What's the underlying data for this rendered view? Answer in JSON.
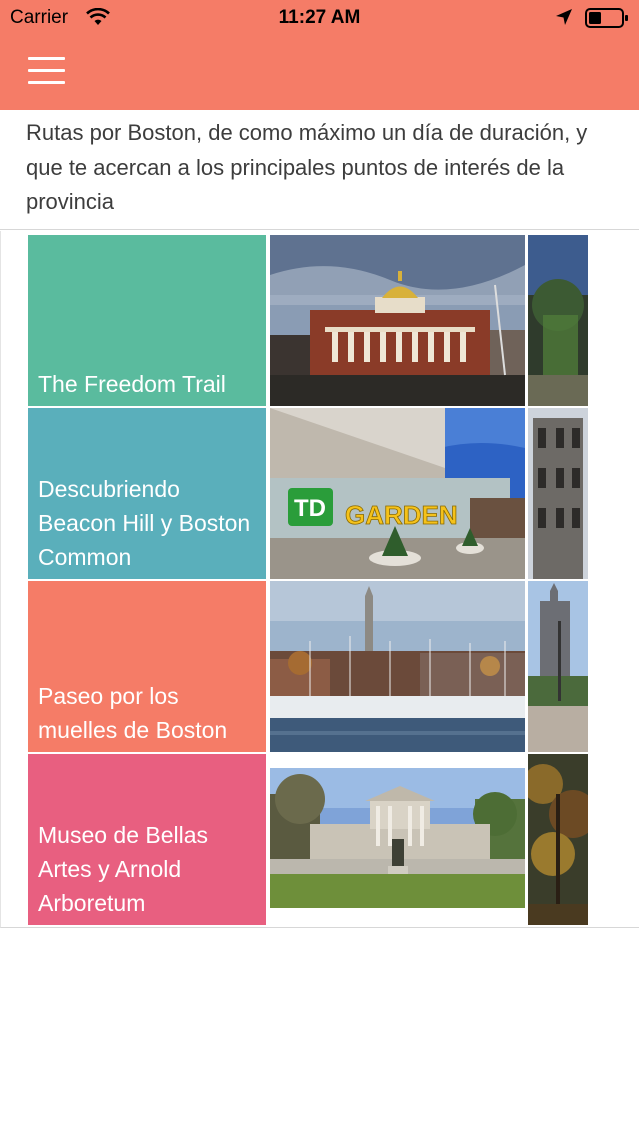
{
  "status_bar": {
    "carrier": "Carrier",
    "time": "11:27 AM"
  },
  "header": {
    "menu_icon": "hamburger-menu-icon",
    "color": "#f57c67"
  },
  "intro": {
    "text": "Rutas por Boston, de como máximo un día de duración, y que te acercan a los principales puntos de interés de la provincia"
  },
  "routes": [
    {
      "title": "The Freedom Trail",
      "color": "#5abb9e",
      "image": "massachusetts-state-house-photo"
    },
    {
      "title": "Descubriendo Beacon Hill y Boston Common",
      "color": "#5aafbb",
      "image": "td-garden-photo",
      "sign_text": "TD GARDEN"
    },
    {
      "title": "Paseo por los muelles de Boston",
      "color": "#f57c67",
      "image": "boston-harbor-marina-photo"
    },
    {
      "title": "Museo de Bellas Artes y Arnold Arboretum",
      "color": "#e85f80",
      "image": "museum-of-fine-arts-photo"
    }
  ]
}
